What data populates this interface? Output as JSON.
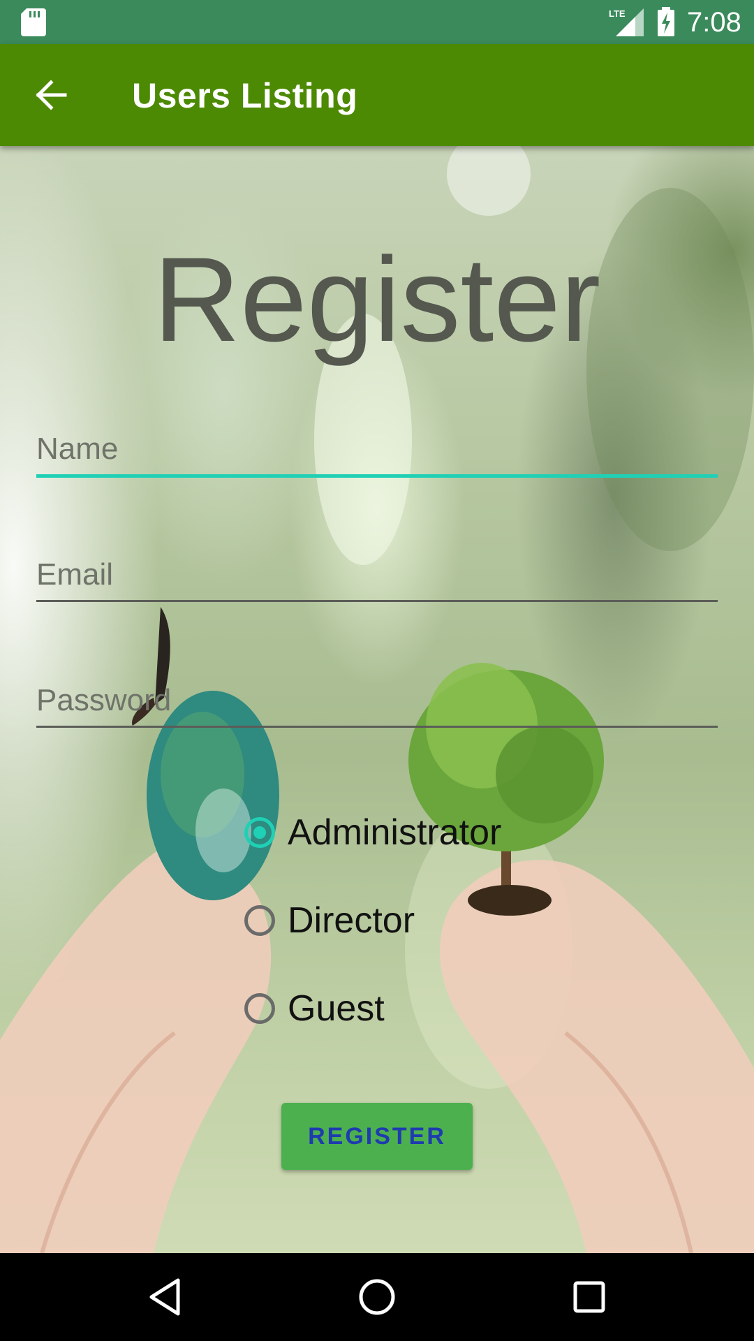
{
  "status_bar": {
    "time": "7:08",
    "network_label": "LTE",
    "icons": [
      "sd-card-icon",
      "lte-signal-icon",
      "battery-charging-icon"
    ]
  },
  "app_bar": {
    "title": "Users Listing",
    "back_icon": "arrow-left-icon"
  },
  "form": {
    "heading": "Register",
    "fields": {
      "name": {
        "placeholder": "Name",
        "value": "",
        "focused": true
      },
      "email": {
        "placeholder": "Email",
        "value": ""
      },
      "password": {
        "placeholder": "Password",
        "value": ""
      }
    },
    "roles": [
      {
        "label": "Administrator",
        "selected": true
      },
      {
        "label": "Director",
        "selected": false
      },
      {
        "label": "Guest",
        "selected": false
      }
    ],
    "submit_label": "REGISTER"
  },
  "nav_bar": {
    "icons": [
      "back-triangle-icon",
      "home-circle-icon",
      "recents-square-icon"
    ]
  },
  "colors": {
    "status_bar": "#3b8a5c",
    "app_bar": "#4c8a04",
    "accent": "#1fd0b5",
    "button": "#4db04f",
    "button_text": "#1e3bb0"
  }
}
